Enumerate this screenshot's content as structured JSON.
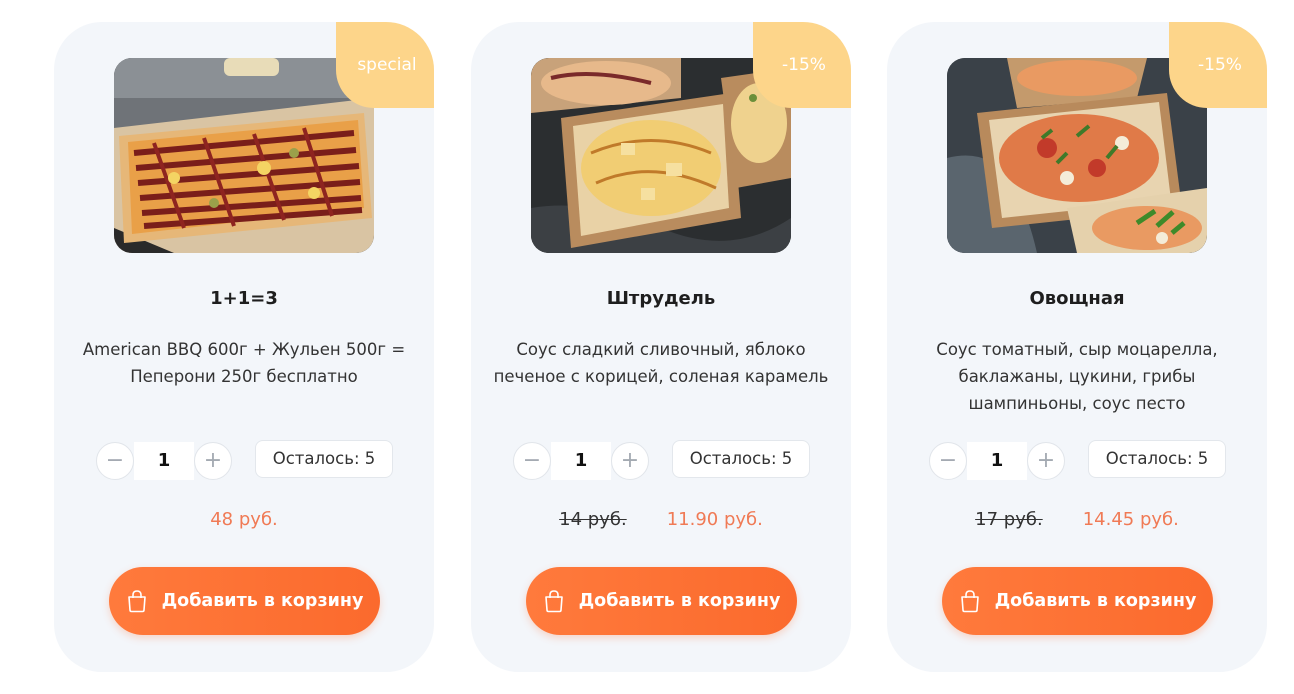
{
  "products": [
    {
      "badge": "special",
      "title": "1+1=3",
      "description": "American BBQ 600г + Жульен 500г = Пеперони 250г бесплатно",
      "quantity": "1",
      "remaining": "Осталось: 5",
      "old_price": "",
      "price": "48 руб.",
      "cart_label": "Добавить в корзину",
      "image": "pizza-bbq-photo"
    },
    {
      "badge": "-15%",
      "title": "Штрудель",
      "description": "Соус сладкий сливочный, яблоко печеное с корицей, соленая карамель",
      "quantity": "1",
      "remaining": "Осталось: 5",
      "old_price": "14 руб.",
      "price": "11.90 руб.",
      "cart_label": "Добавить в корзину",
      "image": "pizza-strudel-photo"
    },
    {
      "badge": "-15%",
      "title": "Овощная",
      "description": "Соус томатный, сыр моцарелла, баклажаны, цукини, грибы шампиньоны, соус песто",
      "quantity": "1",
      "remaining": "Осталось: 5",
      "old_price": "17 руб.",
      "price": "14.45 руб.",
      "cart_label": "Добавить в корзину",
      "image": "pizza-vegetable-photo"
    }
  ],
  "icons": {
    "minus": "−",
    "plus": "+",
    "cart": "shopping-bag-icon"
  },
  "colors": {
    "accent": "#fb6a2d",
    "badge": "#fdd58a",
    "price": "#f07a55",
    "card_bg": "#f3f6fa"
  }
}
